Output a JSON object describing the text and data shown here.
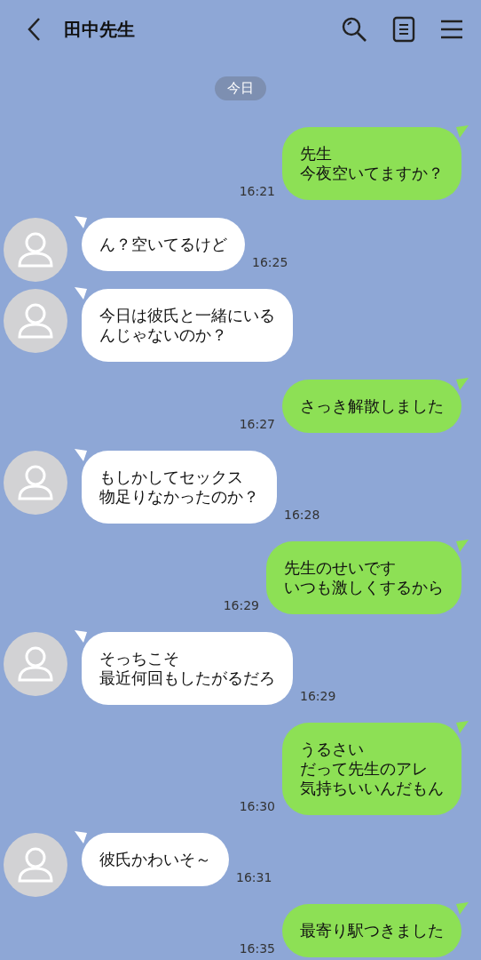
{
  "header": {
    "title": "田中先生"
  },
  "date_label": "今日",
  "messages": [
    {
      "kind": "sent",
      "lines": [
        "先生",
        "今夜空いてますか？"
      ],
      "time": "16:21"
    },
    {
      "kind": "received",
      "lines": [
        "ん？空いてるけど"
      ],
      "time": "16:25"
    },
    {
      "kind": "received",
      "lines": [
        "今日は彼氏と一緒にいる",
        "んじゃないのか？"
      ]
    },
    {
      "kind": "sent",
      "lines": [
        "さっき解散しました"
      ],
      "time": "16:27"
    },
    {
      "kind": "received",
      "lines": [
        "もしかしてセックス",
        "物足りなかったのか？"
      ],
      "time": "16:28"
    },
    {
      "kind": "sent",
      "lines": [
        "先生のせいです",
        "いつも激しくするから"
      ],
      "time": "16:29"
    },
    {
      "kind": "received",
      "lines": [
        "そっちこそ",
        "最近何回もしたがるだろ"
      ],
      "time": "16:29"
    },
    {
      "kind": "sent",
      "lines": [
        "うるさい",
        "だって先生のアレ",
        "気持ちいいんだもん"
      ],
      "time": "16:30"
    },
    {
      "kind": "received",
      "lines": [
        "彼氏かわいそ～"
      ],
      "time": "16:31"
    },
    {
      "kind": "sent",
      "lines": [
        "最寄り駅つきました"
      ],
      "time": "16:35"
    }
  ]
}
